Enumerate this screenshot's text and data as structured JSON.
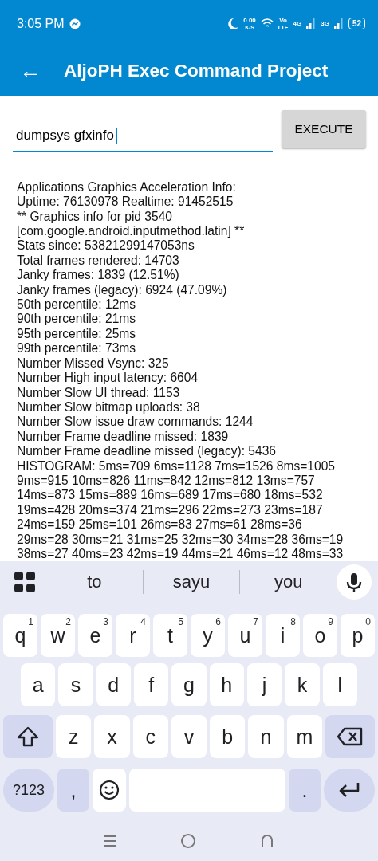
{
  "status_bar": {
    "time": "3:05 PM",
    "speed_value": "0.00",
    "speed_unit": "K/S",
    "volte_top": "Vo",
    "volte_bottom": "LTE",
    "network_1": "4G",
    "network_2": "3G",
    "battery": "52"
  },
  "app_bar": {
    "back_icon": "←",
    "title": "AljoPH Exec Command Project"
  },
  "command": {
    "value": "dumpsys gfxinfo",
    "button": "EXECUTE"
  },
  "output": [
    "Applications Graphics Acceleration Info:",
    "Uptime: 76130978 Realtime: 91452515",
    "** Graphics info for pid 3540",
    "[com.google.android.inputmethod.latin] **",
    "Stats since: 53821299147053ns",
    "Total frames rendered: 14703",
    "Janky frames: 1839 (12.51%)",
    "Janky frames (legacy): 6924 (47.09%)",
    "50th percentile: 12ms",
    "90th percentile: 21ms",
    "95th percentile: 25ms",
    "99th percentile: 73ms",
    "Number Missed Vsync: 325",
    "Number High input latency: 6604",
    "Number Slow UI thread: 1153",
    "Number Slow bitmap uploads: 38",
    "Number Slow issue draw commands: 1244",
    "Number Frame deadline missed: 1839",
    "Number Frame deadline missed (legacy): 5436",
    "HISTOGRAM: 5ms=709 6ms=1128 7ms=1526 8ms=1005",
    "9ms=915 10ms=826 11ms=842 12ms=812 13ms=757",
    "14ms=873 15ms=889 16ms=689 17ms=680 18ms=532",
    "19ms=428 20ms=374 21ms=296 22ms=273 23ms=187",
    "24ms=159 25ms=101 26ms=83 27ms=61 28ms=36",
    "29ms=28 30ms=21 31ms=25 32ms=30 34ms=28 36ms=19",
    "38ms=27 40ms=23 42ms=19 44ms=21 46ms=12 48ms=33"
  ],
  "keyboard": {
    "suggestions": [
      "to",
      "sayu",
      "you"
    ],
    "rows": [
      {
        "keys": [
          {
            "kind": "letter",
            "label": "q",
            "hint": "1"
          },
          {
            "kind": "letter",
            "label": "w",
            "hint": "2"
          },
          {
            "kind": "letter",
            "label": "e",
            "hint": "3"
          },
          {
            "kind": "letter",
            "label": "r",
            "hint": "4"
          },
          {
            "kind": "letter",
            "label": "t",
            "hint": "5"
          },
          {
            "kind": "letter",
            "label": "y",
            "hint": "6"
          },
          {
            "kind": "letter",
            "label": "u",
            "hint": "7"
          },
          {
            "kind": "letter",
            "label": "i",
            "hint": "8"
          },
          {
            "kind": "letter",
            "label": "o",
            "hint": "9"
          },
          {
            "kind": "letter",
            "label": "p",
            "hint": "0"
          }
        ]
      },
      {
        "keys": [
          {
            "kind": "letter",
            "label": "a"
          },
          {
            "kind": "letter",
            "label": "s"
          },
          {
            "kind": "letter",
            "label": "d"
          },
          {
            "kind": "letter",
            "label": "f"
          },
          {
            "kind": "letter",
            "label": "g"
          },
          {
            "kind": "letter",
            "label": "h"
          },
          {
            "kind": "letter",
            "label": "j"
          },
          {
            "kind": "letter",
            "label": "k"
          },
          {
            "kind": "letter",
            "label": "l"
          }
        ]
      },
      {
        "keys": [
          {
            "kind": "shift"
          },
          {
            "kind": "letter",
            "label": "z"
          },
          {
            "kind": "letter",
            "label": "x"
          },
          {
            "kind": "letter",
            "label": "c"
          },
          {
            "kind": "letter",
            "label": "v"
          },
          {
            "kind": "letter",
            "label": "b"
          },
          {
            "kind": "letter",
            "label": "n"
          },
          {
            "kind": "letter",
            "label": "m"
          },
          {
            "kind": "backspace"
          }
        ]
      },
      {
        "keys": [
          {
            "kind": "symbols",
            "label": "?123"
          },
          {
            "kind": "punct",
            "label": ","
          },
          {
            "kind": "emoji"
          },
          {
            "kind": "space"
          },
          {
            "kind": "punct",
            "label": "."
          },
          {
            "kind": "enter"
          }
        ]
      }
    ]
  }
}
